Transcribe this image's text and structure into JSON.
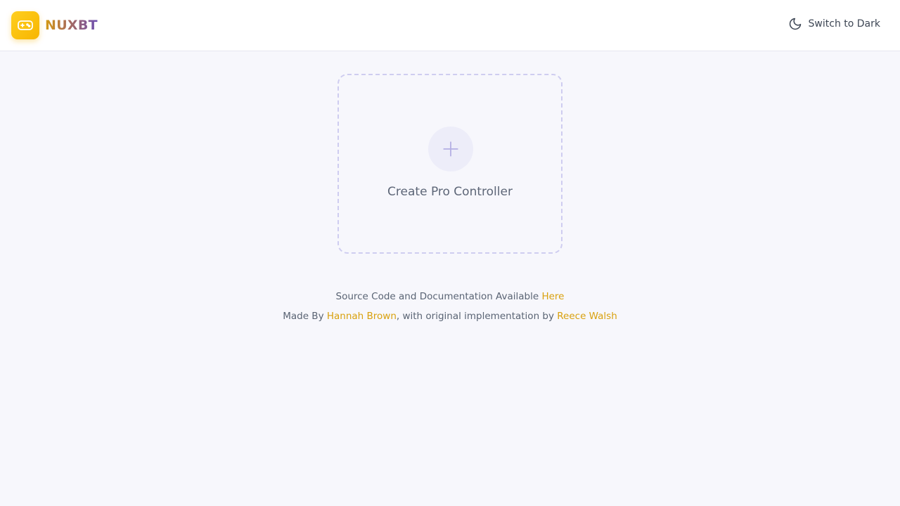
{
  "header": {
    "brand_name": "NUXBT",
    "logo_icon": "gamepad-icon",
    "theme_toggle_label": "Switch to Dark",
    "theme_toggle_icon": "moon-icon"
  },
  "main": {
    "create_card_label": "Create Pro Controller",
    "create_card_icon": "plus-icon"
  },
  "footer": {
    "line1_text": "Source Code and Documentation Available ",
    "line1_link": "Here",
    "line2_prefix": "Made By ",
    "line2_author": "Hannah Brown",
    "line2_middle": ", with original implementation by ",
    "line2_original_author": "Reece Walsh"
  },
  "colors": {
    "accent": "#f7b500",
    "link": "#d9a10e",
    "background": "#f7f7fc",
    "card_border": "#cfcdf0",
    "brand_purple": "#6c4fb3"
  }
}
